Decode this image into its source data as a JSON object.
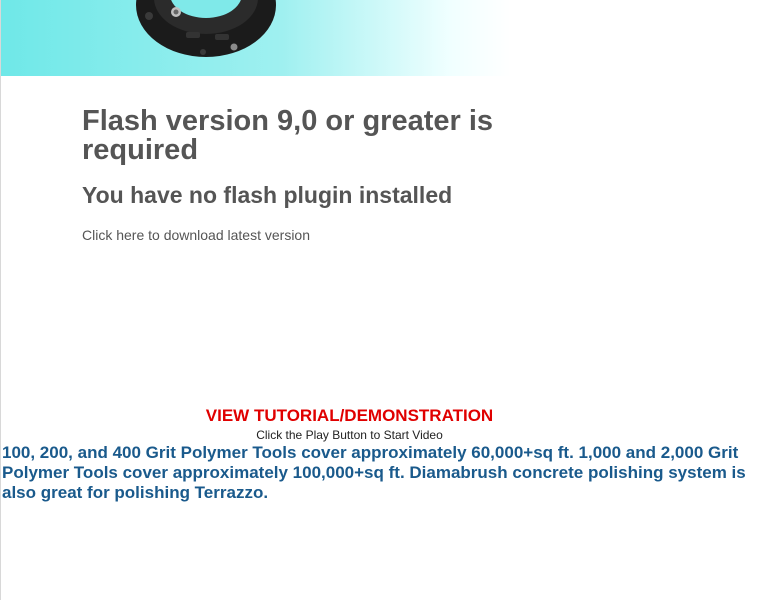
{
  "flash": {
    "title": "Flash version 9,0 or greater is required",
    "subtitle": "You have no flash plugin installed",
    "download_link": "Click here to download latest version"
  },
  "tutorial": {
    "title": "VIEW TUTORIAL/DEMONSTRATION",
    "hint": "Click the Play Button to Start Video"
  },
  "description": "100, 200, and 400 Grit Polymer Tools cover approximately 60,000+sq ft. 1,000 and 2,000 Grit Polymer Tools cover approximately 100,000+sq ft. Diamabrush concrete polishing system is also great for polishing Terrazzo.",
  "colors": {
    "banner_gradient_start": "#6fe8e8",
    "flash_text": "#555555",
    "tutorial_title": "#e00000",
    "description_text": "#1a5a8c"
  }
}
